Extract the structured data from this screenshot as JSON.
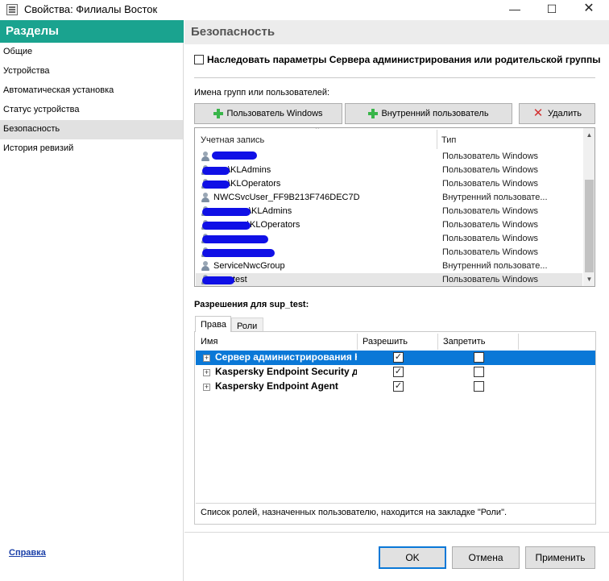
{
  "window": {
    "title": "Свойства: Филиалы Восток",
    "controls": {
      "minimize": "—",
      "maximize": "☐",
      "close": "✕"
    }
  },
  "nav": {
    "header": "Разделы",
    "items": [
      {
        "label": "Общие"
      },
      {
        "label": "Устройства"
      },
      {
        "label": "Автоматическая установка"
      },
      {
        "label": "Статус устройства"
      },
      {
        "label": "Безопасность",
        "selected": true
      },
      {
        "label": "История ревизий"
      }
    ]
  },
  "section": {
    "title": "Безопасность",
    "inherit_label": "Наследовать параметры Сервера администрирования или родительской группы",
    "inherit_checked": false,
    "groups_label": "Имена групп или пользователей:",
    "buttons": {
      "add_windows_user": "Пользователь Windows",
      "add_internal_user": "Внутренний пользователь",
      "delete": "Удалить"
    },
    "columns": {
      "account": "Учетная запись",
      "type": "Тип"
    },
    "users": [
      {
        "name": "",
        "type": "Пользователь Windows"
      },
      {
        "name": "\\KLAdmins",
        "type": "Пользователь Windows"
      },
      {
        "name": "\\KLOperators",
        "type": "Пользователь Windows"
      },
      {
        "name": "NWCSvcUser_FF9B213F746DEC7D",
        "type": "Внутренний пользовате..."
      },
      {
        "name": "\\KLAdmins",
        "type": "Пользователь Windows"
      },
      {
        "name": "\\KLOperators",
        "type": "Пользователь Windows"
      },
      {
        "name": "",
        "type": "Пользователь Windows"
      },
      {
        "name": "",
        "type": "Пользователь Windows"
      },
      {
        "name": "ServiceNwcGroup",
        "type": "Внутренний пользовате..."
      },
      {
        "name": "test",
        "type": "Пользователь Windows",
        "selected": true
      }
    ],
    "permissions_title": "Разрешения для sup_test:",
    "tabs": [
      {
        "label": "Права",
        "active": true
      },
      {
        "label": "Роли"
      }
    ],
    "perm_columns": {
      "name": "Имя",
      "allow": "Разрешить",
      "deny": "Запретить"
    },
    "permissions": [
      {
        "name": "Сервер администрирования К",
        "allow": true,
        "deny": false,
        "selected": true
      },
      {
        "name": "Kaspersky Endpoint Security дл",
        "allow": true,
        "deny": false
      },
      {
        "name": "Kaspersky Endpoint Agent",
        "allow": true,
        "deny": false
      }
    ],
    "note": "Список ролей, назначенных пользователю, находится на закладке \"Роли\"."
  },
  "footer": {
    "help": "Справка",
    "ok": "OK",
    "cancel": "Отмена",
    "apply": "Применить"
  },
  "colors": {
    "nav_header_bg": "#1aa38f",
    "selection_blue": "#0a78d7",
    "redaction_blue": "#1010e6",
    "add_icon_green": "#39b54a",
    "delete_icon_red": "#d32f2f"
  }
}
